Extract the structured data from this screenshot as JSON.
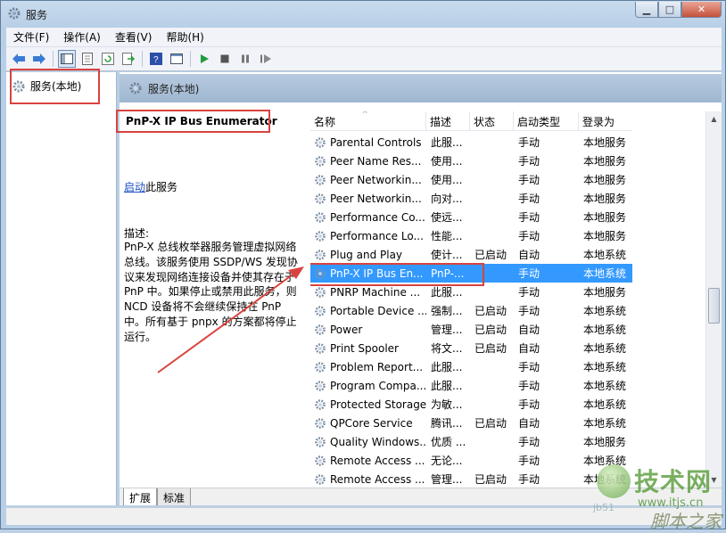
{
  "window": {
    "title": "服务",
    "min_glyph": "▁",
    "max_glyph": "□",
    "close_glyph": "✕"
  },
  "menu": [
    "文件(F)",
    "操作(A)",
    "查看(V)",
    "帮助(H)"
  ],
  "tree": {
    "root_label": "服务(本地)"
  },
  "content_header": {
    "label": "服务(本地)"
  },
  "details": {
    "service_name": "PnP-X IP Bus Enumerator",
    "start_link": "启动",
    "start_suffix": "此服务",
    "desc_label": "描述:",
    "desc_text": "PnP-X 总线枚举器服务管理虚拟网络总线。该服务使用 SSDP/WS 发现协议来发现网络连接设备并使其存在于 PnP 中。如果停止或禁用此服务，则 NCD 设备将不会继续保持在 PnP 中。所有基于 pnpx 的方案都将停止运行。"
  },
  "columns": {
    "name": "名称",
    "desc": "描述",
    "status": "状态",
    "start": "启动类型",
    "logon": "登录为",
    "sort_caret": "^"
  },
  "rows": [
    {
      "name": "Parental Controls",
      "desc": "此服...",
      "status": "",
      "start": "手动",
      "logon": "本地服务"
    },
    {
      "name": "Peer Name Res...",
      "desc": "使用...",
      "status": "",
      "start": "手动",
      "logon": "本地服务"
    },
    {
      "name": "Peer Networkin...",
      "desc": "使用...",
      "status": "",
      "start": "手动",
      "logon": "本地服务"
    },
    {
      "name": "Peer Networkin...",
      "desc": "向对...",
      "status": "",
      "start": "手动",
      "logon": "本地服务"
    },
    {
      "name": "Performance Co...",
      "desc": "使远...",
      "status": "",
      "start": "手动",
      "logon": "本地服务"
    },
    {
      "name": "Performance Lo...",
      "desc": "性能...",
      "status": "",
      "start": "手动",
      "logon": "本地服务"
    },
    {
      "name": "Plug and Play",
      "desc": "使计...",
      "status": "已启动",
      "start": "自动",
      "logon": "本地系统"
    },
    {
      "name": "PnP-X IP Bus En...",
      "desc": "PnP-...",
      "status": "",
      "start": "手动",
      "logon": "本地系统"
    },
    {
      "name": "PNRP Machine ...",
      "desc": "此服...",
      "status": "",
      "start": "手动",
      "logon": "本地服务"
    },
    {
      "name": "Portable Device ...",
      "desc": "强制...",
      "status": "已启动",
      "start": "手动",
      "logon": "本地系统"
    },
    {
      "name": "Power",
      "desc": "管理...",
      "status": "已启动",
      "start": "自动",
      "logon": "本地系统"
    },
    {
      "name": "Print Spooler",
      "desc": "将文...",
      "status": "已启动",
      "start": "自动",
      "logon": "本地系统"
    },
    {
      "name": "Problem Report...",
      "desc": "此服...",
      "status": "",
      "start": "手动",
      "logon": "本地系统"
    },
    {
      "name": "Program Compa...",
      "desc": "此服...",
      "status": "",
      "start": "手动",
      "logon": "本地系统"
    },
    {
      "name": "Protected Storage",
      "desc": "为敏...",
      "status": "",
      "start": "手动",
      "logon": "本地系统"
    },
    {
      "name": "QPCore Service",
      "desc": "腾讯...",
      "status": "已启动",
      "start": "自动",
      "logon": "本地系统"
    },
    {
      "name": "Quality Windows...",
      "desc": "优质 ...",
      "status": "",
      "start": "手动",
      "logon": "本地服务"
    },
    {
      "name": "Remote Access ...",
      "desc": "无论...",
      "status": "",
      "start": "手动",
      "logon": "本地系统"
    },
    {
      "name": "Remote Access ...",
      "desc": "管理...",
      "status": "已启动",
      "start": "手动",
      "logon": "本地系统"
    }
  ],
  "tabs": [
    "扩展",
    "标准"
  ],
  "watermark": {
    "brand": "技术网",
    "url": "www.itjs.cn",
    "foot": "脚本之家",
    "small": "jb51"
  },
  "colors": {
    "selection": "#3399ff",
    "highlight_box": "#d9433f",
    "link": "#1a4fbf"
  }
}
